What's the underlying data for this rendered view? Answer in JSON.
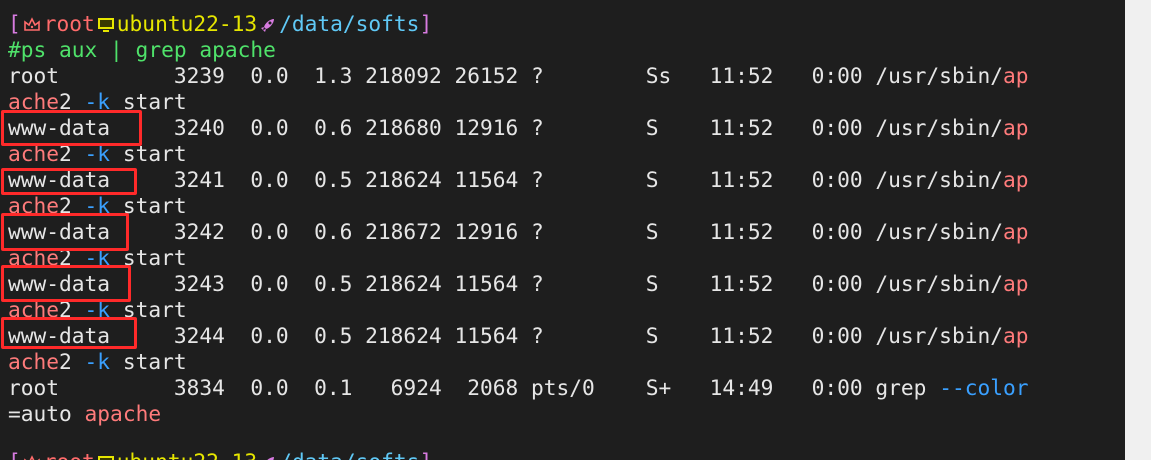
{
  "prompt": {
    "open_bracket": "[",
    "user": "root",
    "host": "ubuntu22-13",
    "path": "/data/softs",
    "close_bracket": "]"
  },
  "command": "#ps aux | grep apache",
  "processes": [
    {
      "cols": "root         3239  0.0  1.3 218092 26152 ?        Ss   11:52   0:00 /usr/sbin/",
      "tail": "ap",
      "wrap_a": "ache",
      "wrap_b": "2 ",
      "wrap_opt": "-k",
      "wrap_c": " start"
    },
    {
      "cols": "www-data     3240  0.0  0.6 218680 12916 ?        S    11:52   0:00 /usr/sbin/",
      "tail": "ap",
      "wrap_a": "ache",
      "wrap_b": "2 ",
      "wrap_opt": "-k",
      "wrap_c": " start"
    },
    {
      "cols": "www-data     3241  0.0  0.5 218624 11564 ?        S    11:52   0:00 /usr/sbin/",
      "tail": "ap",
      "wrap_a": "ache",
      "wrap_b": "2 ",
      "wrap_opt": "-k",
      "wrap_c": " start"
    },
    {
      "cols": "www-data     3242  0.0  0.6 218672 12916 ?        S    11:52   0:00 /usr/sbin/",
      "tail": "ap",
      "wrap_a": "ache",
      "wrap_b": "2 ",
      "wrap_opt": "-k",
      "wrap_c": " start"
    },
    {
      "cols": "www-data     3243  0.0  0.5 218624 11564 ?        S    11:52   0:00 /usr/sbin/",
      "tail": "ap",
      "wrap_a": "ache",
      "wrap_b": "2 ",
      "wrap_opt": "-k",
      "wrap_c": " start"
    },
    {
      "cols": "www-data     3244  0.0  0.5 218624 11564 ?        S    11:52   0:00 /usr/sbin/",
      "tail": "ap",
      "wrap_a": "ache",
      "wrap_b": "2 ",
      "wrap_opt": "-k",
      "wrap_c": " start"
    }
  ],
  "grep_line": {
    "cols": "root         3834  0.0  0.1   6924  2068 pts/0    S+   14:49   0:00 grep ",
    "opt": "--color",
    "wrap_a": "=auto ",
    "wrap_b": "apache"
  },
  "colors": {
    "background": "#1e1e1e",
    "highlight_border": "#ff2a2a",
    "apache_match": "#ff7b7b",
    "command": "#4fe26a"
  },
  "icons": [
    "crown-icon",
    "computer-icon",
    "rocket-icon"
  ]
}
